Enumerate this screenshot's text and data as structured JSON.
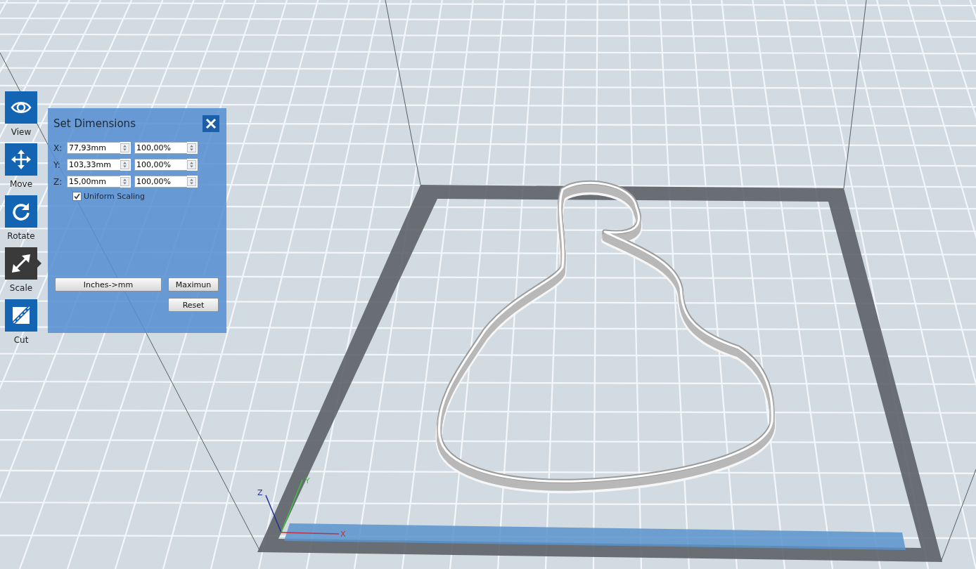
{
  "toolbar": [
    {
      "label": "View",
      "kind": "view",
      "selected": false
    },
    {
      "label": "Move",
      "kind": "move",
      "selected": false
    },
    {
      "label": "Rotate",
      "kind": "rotate",
      "selected": false
    },
    {
      "label": "Scale",
      "kind": "scale",
      "selected": true
    },
    {
      "label": "Cut",
      "kind": "cut",
      "selected": false
    }
  ],
  "panel": {
    "title": "Set Dimensions",
    "rows": [
      {
        "axis": "X:",
        "size": "77,93mm",
        "percent": "100,00%"
      },
      {
        "axis": "Y:",
        "size": "103,33mm",
        "percent": "100,00%"
      },
      {
        "axis": "Z:",
        "size": "15,00mm",
        "percent": "100,00%"
      }
    ],
    "uniform_scaling": {
      "label": "Uniform Scaling",
      "checked": true
    },
    "buttons": [
      "Inches->mm",
      "Maximun",
      "Reset"
    ]
  },
  "viewport": {
    "axes": [
      "Z",
      "Y",
      "X"
    ]
  }
}
